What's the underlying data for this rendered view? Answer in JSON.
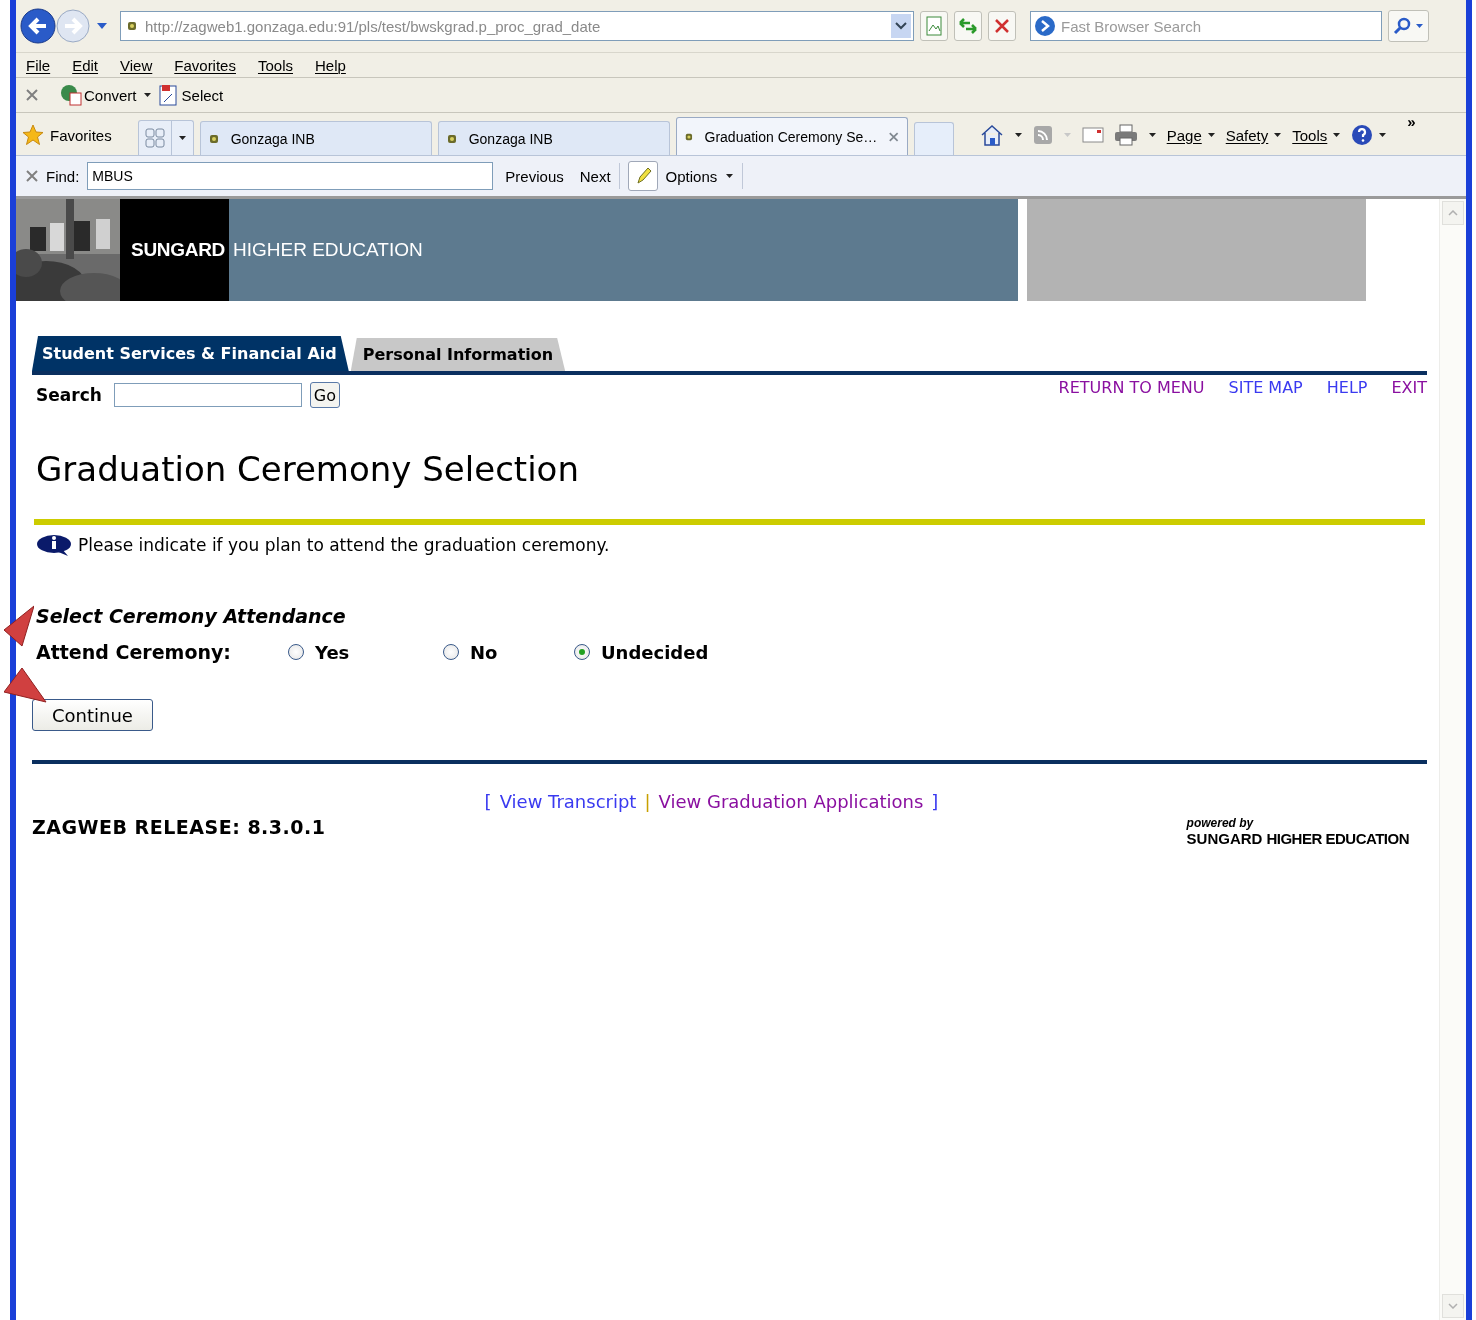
{
  "browser": {
    "address": "http://zagweb1.gonzaga.edu:91/pls/test/bwskgrad.p_proc_grad_date",
    "search": {
      "placeholder": "Fast Browser Search"
    },
    "menu": [
      "File",
      "Edit",
      "View",
      "Favorites",
      "Tools",
      "Help"
    ],
    "toolbar": [
      "Convert",
      "Select"
    ],
    "favorites": "Favorites",
    "tabs": [
      {
        "label": "Gonzaga INB",
        "selected": false
      },
      {
        "label": "Gonzaga INB",
        "selected": false
      },
      {
        "label": "Graduation Ceremony Se…",
        "selected": true
      }
    ],
    "commands": [
      "Page",
      "Safety",
      "Tools"
    ],
    "overflow": "»",
    "find": {
      "label": "Find:",
      "value": "MBUS",
      "previous": "Previous",
      "next": "Next",
      "options": "Options"
    }
  },
  "banner": {
    "brand": "SUNGARD",
    "subtitle": "HIGHER EDUCATION"
  },
  "page": {
    "nav_tabs": [
      {
        "label": "Student Services & Financial Aid",
        "selected": true
      },
      {
        "label": "Personal Information",
        "selected": false
      }
    ],
    "search_label": "Search",
    "go": "Go",
    "links": [
      {
        "label": "RETURN TO MENU",
        "visited": true
      },
      {
        "label": "SITE MAP",
        "visited": false
      },
      {
        "label": "HELP",
        "visited": false
      },
      {
        "label": "EXIT",
        "visited": true
      }
    ],
    "title": "Graduation Ceremony Selection",
    "info": "Please indicate if you plan to attend the graduation ceremony.",
    "section": "Select Ceremony Attendance",
    "field_label": "Attend Ceremony:",
    "options": [
      {
        "label": "Yes",
        "selected": false
      },
      {
        "label": "No",
        "selected": false
      },
      {
        "label": "Undecided",
        "selected": true
      }
    ],
    "continue": "Continue",
    "footer": {
      "open": "[",
      "separator": "|",
      "close": "]",
      "links": [
        {
          "label": "View Transcript",
          "visited": false
        },
        {
          "label": "View Graduation Applications",
          "visited": true
        }
      ]
    },
    "release": "ZAGWEB RELEASE: 8.3.0.1",
    "powered": {
      "by": "powered by",
      "brand": "SUNGARD",
      "subtitle": "HIGHER EDUCATION"
    }
  }
}
